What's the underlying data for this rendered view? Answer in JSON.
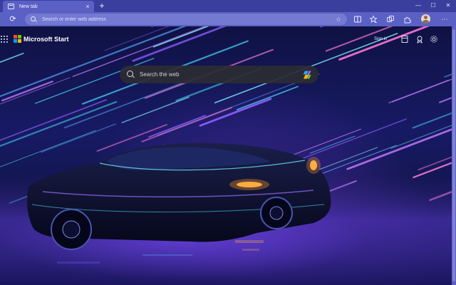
{
  "tab": {
    "title": "New tab",
    "close_label": "×",
    "new_tab_label": "+"
  },
  "window_controls": {
    "minimize": "—",
    "maximize": "☐",
    "close": "✕"
  },
  "toolbar": {
    "refresh_label": "⟳",
    "address_placeholder": "Search or enter web address",
    "icons": [
      "split-screen-icon",
      "favorites-icon",
      "collections-icon",
      "extensions-icon",
      "profile-icon"
    ]
  },
  "newtab_page": {
    "brand": "Microsoft Start",
    "sign_in": "Sign in",
    "search_placeholder": "Search the web",
    "icons": [
      "apps-grid-icon",
      "microsoft-logo-icon",
      "layout-icon",
      "rewards-icon",
      "settings-icon",
      "copilot-icon"
    ]
  },
  "colors": {
    "titlebar": "#3a3f9e",
    "toolbar": "#5a60c4",
    "addressbar": "#7479d2",
    "searchbox": "#2c2c34"
  }
}
